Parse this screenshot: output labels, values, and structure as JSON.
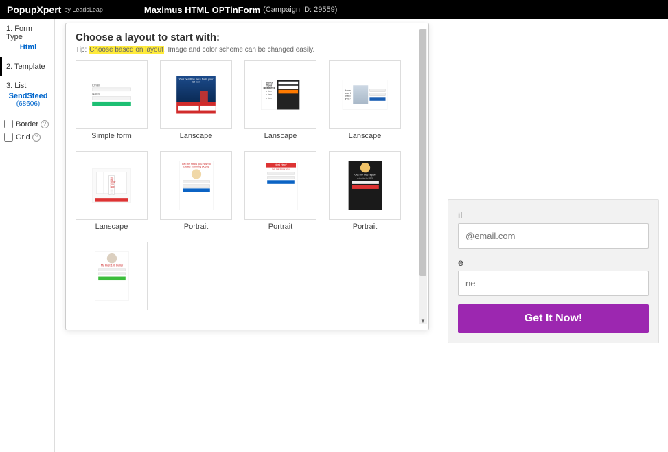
{
  "header": {
    "logo": "PopupXpert",
    "logo_sub": "by LeadsLeap",
    "title": "Maximus HTML OPTinForm",
    "campaign": "(Campaign ID: 29559)"
  },
  "sidebar": {
    "steps": [
      {
        "label": "1. Form Type",
        "value": "Html"
      },
      {
        "label": "2. Template",
        "value": ""
      },
      {
        "label": "3. List",
        "value": "SendSteed",
        "subvalue": "(68606)"
      }
    ],
    "options": [
      {
        "label": "Border"
      },
      {
        "label": "Grid"
      }
    ]
  },
  "modal": {
    "title": "Choose a layout to start with:",
    "tip_prefix": "Tip: ",
    "tip_highlight": "Choose based on layout",
    "tip_suffix": ". Image and color scheme can be changed easily.",
    "templates": [
      {
        "caption": "Simple form"
      },
      {
        "caption": "Lanscape"
      },
      {
        "caption": "Lanscape"
      },
      {
        "caption": "Lanscape"
      },
      {
        "caption": "Lanscape"
      },
      {
        "caption": "Portrait"
      },
      {
        "caption": "Portrait"
      },
      {
        "caption": "Portrait"
      },
      {
        "caption": ""
      }
    ]
  },
  "preview": {
    "email_label_fragment": "il",
    "email_placeholder_fragment": "@email.com",
    "name_label_fragment": "e",
    "name_placeholder_fragment": "ne",
    "button": "Get It Now!"
  }
}
